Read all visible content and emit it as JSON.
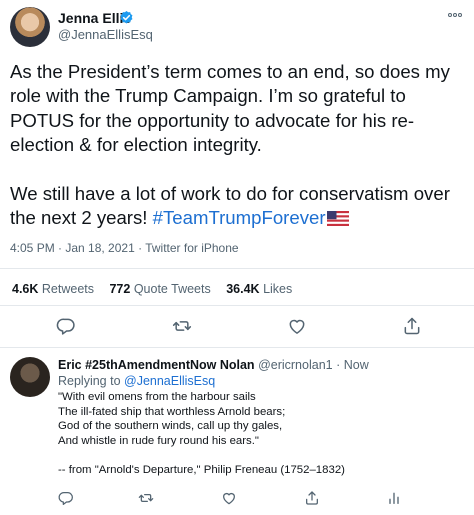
{
  "tweet": {
    "author_name": "Jenna Ellis",
    "author_handle": "@JennaEllisEsq",
    "text_main": "As the President’s term comes to an end, so does my role with the Trump Campaign. I’m so grateful to POTUS for the opportunity to advocate for his re-election & for election integrity.\n\nWe still have a lot of work to do for conservatism over the next 2 years! ",
    "hashtag": "#TeamTrumpForever",
    "meta": "4:05 PM · Jan 18, 2021 · Twitter for iPhone",
    "stats": {
      "retweets_count": "4.6K",
      "retweets_label": "Retweets",
      "quotes_count": "772",
      "quotes_label": "Quote Tweets",
      "likes_count": "36.4K",
      "likes_label": "Likes"
    }
  },
  "reply": {
    "author_name": "Eric #25thAmendmentNow Nolan",
    "author_handle": "@ericrnolan1",
    "time": "· Now",
    "replying_prefix": "Replying to ",
    "replying_mention": "@JennaEllisEsq",
    "text": "\"With evil omens from the harbour sails\n The ill-fated ship that worthless Arnold bears;\nGod of the southern winds, call up thy gales,\nAnd whistle in rude fury round his ears.\"\n\n-- from \"Arnold's Departure,\" Philip Freneau (1752–1832)"
  },
  "colors": {
    "link": "#1d6fd1",
    "secondary_text": "#536471",
    "divider": "#e4e8ec",
    "verified": "#1d9bf0"
  },
  "icons": [
    "verified-badge-icon",
    "more-icon",
    "reply-icon",
    "retweet-icon",
    "like-icon",
    "share-icon",
    "analytics-icon",
    "us-flag-emoji"
  ]
}
